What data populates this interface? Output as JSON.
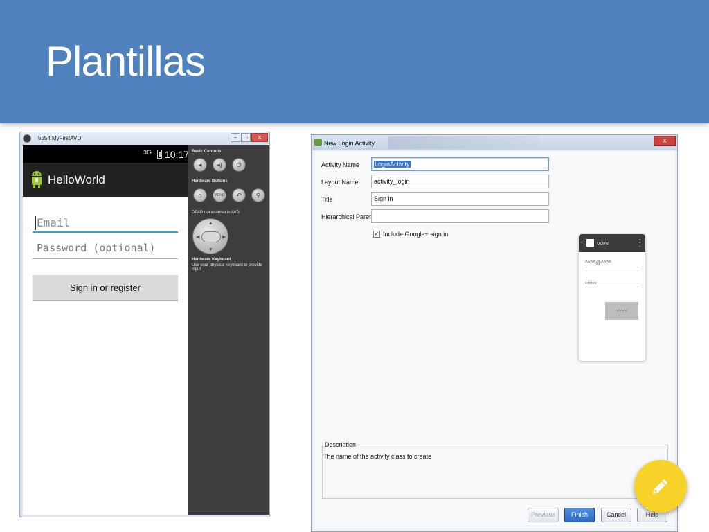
{
  "slide": {
    "title": "Plantillas"
  },
  "emulator": {
    "window_title": "5554:MyFirstAVD",
    "status_net": "3G",
    "clock": "10:17",
    "app_name": "HelloWorld",
    "email_placeholder": "Email",
    "password_placeholder": "Password (optional)",
    "sign_in_label": "Sign in or register",
    "controls": {
      "basic_controls": "Basic Controls",
      "hardware_buttons": "Hardware Buttons",
      "menu_label": "MENU",
      "dpad_note": "DPAD not enabled in AVD",
      "hardware_keyboard": "Hardware Keyboard",
      "keyboard_note": "Use your physical keyboard to provide input"
    }
  },
  "wizard": {
    "window_title": "New Login Activity",
    "close_label": "x",
    "fields": {
      "activity_name_label": "Activity Name",
      "activity_name_value": "LoginActivity",
      "layout_name_label": "Layout Name",
      "layout_name_value": "activity_login",
      "title_label": "Title",
      "title_value": "Sign in",
      "hierarchical_parent_label": "Hierarchical Parent",
      "hierarchical_parent_value": ""
    },
    "include_google_label": "Include Google+ sign in",
    "include_google_checked": true,
    "preview": {
      "email_field": "^^^^@^^^^",
      "password_field": "••••••"
    },
    "description_legend": "Description",
    "description_text": "The name of the activity class to create",
    "buttons": {
      "previous": "Previous",
      "finish": "Finish",
      "cancel": "Cancel",
      "help": "Help"
    }
  },
  "colors": {
    "banner": "#4f81bd",
    "fab": "#f7d32a",
    "focus_underline": "#33a5c9"
  },
  "icons": {
    "fab": "pencil-icon"
  }
}
